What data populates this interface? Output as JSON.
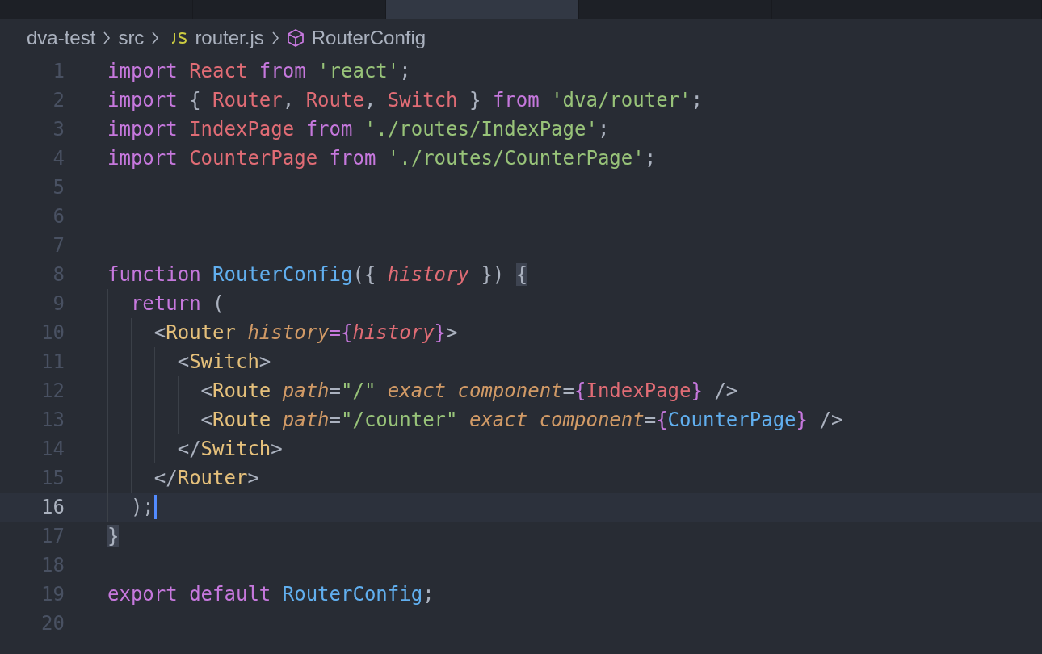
{
  "tabs": [
    {
      "selected": false
    },
    {
      "selected": false
    },
    {
      "selected": true
    },
    {
      "selected": false
    },
    {
      "selected": false
    }
  ],
  "breadcrumb": [
    {
      "text": "dva-test",
      "kind": "folder"
    },
    {
      "text": "src",
      "kind": "folder"
    },
    {
      "text": "router.js",
      "kind": "js-file"
    },
    {
      "text": "RouterConfig",
      "kind": "symbol"
    }
  ],
  "lines": [
    {
      "number": "1",
      "current": false,
      "tokens": [
        {
          "t": "import",
          "kind": "kw"
        },
        {
          "t": " React",
          "kind": "var"
        },
        {
          "t": " from",
          "kind": "kw"
        },
        {
          "t": " 'react'",
          "kind": "str"
        },
        {
          "t": ";",
          "kind": "p"
        }
      ]
    },
    {
      "number": "2",
      "current": false,
      "tokens": [
        {
          "t": "import",
          "kind": "kw"
        },
        {
          "t": " { ",
          "kind": "p"
        },
        {
          "t": "Router",
          "kind": "var"
        },
        {
          "t": ", ",
          "kind": "p"
        },
        {
          "t": "Route",
          "kind": "var"
        },
        {
          "t": ", ",
          "kind": "p"
        },
        {
          "t": "Switch",
          "kind": "var"
        },
        {
          "t": " } ",
          "kind": "p"
        },
        {
          "t": "from",
          "kind": "kw"
        },
        {
          "t": " 'dva/router'",
          "kind": "str"
        },
        {
          "t": ";",
          "kind": "p"
        }
      ]
    },
    {
      "number": "3",
      "current": false,
      "tokens": [
        {
          "t": "import",
          "kind": "kw"
        },
        {
          "t": " IndexPage",
          "kind": "var"
        },
        {
          "t": " from",
          "kind": "kw"
        },
        {
          "t": " './routes/IndexPage'",
          "kind": "str"
        },
        {
          "t": ";",
          "kind": "p"
        }
      ]
    },
    {
      "number": "4",
      "current": false,
      "tokens": [
        {
          "t": "import",
          "kind": "kw"
        },
        {
          "t": " CounterPage",
          "kind": "var"
        },
        {
          "t": " from",
          "kind": "kw"
        },
        {
          "t": " './routes/CounterPage'",
          "kind": "str"
        },
        {
          "t": ";",
          "kind": "p"
        }
      ]
    },
    {
      "number": "5",
      "current": false
    },
    {
      "number": "6",
      "current": false
    },
    {
      "number": "7",
      "current": false
    },
    {
      "number": "8",
      "current": false,
      "tokens": [
        {
          "t": "function",
          "kind": "kw"
        },
        {
          "t": " RouterConfig",
          "kind": "fn"
        },
        {
          "t": "({ ",
          "kind": "p"
        },
        {
          "t": "history",
          "kind": "param"
        },
        {
          "t": " }) ",
          "kind": "p"
        },
        {
          "t": "{",
          "kind": "match"
        }
      ]
    },
    {
      "number": "9",
      "current": false,
      "tokens": [
        {
          "t": "  return",
          "kind": "kw"
        },
        {
          "t": " (",
          "kind": "p"
        }
      ]
    },
    {
      "number": "10",
      "current": false,
      "tokens": [
        {
          "t": "    <",
          "kind": "p"
        },
        {
          "t": "Router",
          "kind": "tag"
        },
        {
          "t": " history",
          "kind": "attr"
        },
        {
          "t": "=",
          "kind": "kw"
        },
        {
          "t": "{",
          "kind": "kw"
        },
        {
          "t": "history",
          "kind": "param"
        },
        {
          "t": "}",
          "kind": "kw"
        },
        {
          "t": ">",
          "kind": "p"
        }
      ]
    },
    {
      "number": "11",
      "current": false,
      "tokens": [
        {
          "t": "      <",
          "kind": "p"
        },
        {
          "t": "Switch",
          "kind": "tag"
        },
        {
          "t": ">",
          "kind": "p"
        }
      ]
    },
    {
      "number": "12",
      "current": false,
      "tokens": [
        {
          "t": "        <",
          "kind": "p"
        },
        {
          "t": "Route",
          "kind": "tag"
        },
        {
          "t": " path",
          "kind": "attr"
        },
        {
          "t": "=",
          "kind": "p"
        },
        {
          "t": "\"/\"",
          "kind": "str"
        },
        {
          "t": " exact",
          "kind": "attr"
        },
        {
          "t": " component",
          "kind": "attr"
        },
        {
          "t": "=",
          "kind": "p"
        },
        {
          "t": "{",
          "kind": "kw"
        },
        {
          "t": "IndexPage",
          "kind": "var"
        },
        {
          "t": "}",
          "kind": "kw"
        },
        {
          "t": " />",
          "kind": "p"
        }
      ]
    },
    {
      "number": "13",
      "current": false,
      "tokens": [
        {
          "t": "        <",
          "kind": "p"
        },
        {
          "t": "Route",
          "kind": "tag"
        },
        {
          "t": " path",
          "kind": "attr"
        },
        {
          "t": "=",
          "kind": "p"
        },
        {
          "t": "\"/counter\"",
          "kind": "str"
        },
        {
          "t": " exact",
          "kind": "attr"
        },
        {
          "t": " component",
          "kind": "attr"
        },
        {
          "t": "=",
          "kind": "p"
        },
        {
          "t": "{",
          "kind": "kw"
        },
        {
          "t": "CounterPage",
          "kind": "fn"
        },
        {
          "t": "}",
          "kind": "kw"
        },
        {
          "t": " />",
          "kind": "p"
        }
      ]
    },
    {
      "number": "14",
      "current": false,
      "tokens": [
        {
          "t": "      </",
          "kind": "p"
        },
        {
          "t": "Switch",
          "kind": "tag"
        },
        {
          "t": ">",
          "kind": "p"
        }
      ]
    },
    {
      "number": "15",
      "current": false,
      "tokens": [
        {
          "t": "    </",
          "kind": "p"
        },
        {
          "t": "Router",
          "kind": "tag"
        },
        {
          "t": ">",
          "kind": "p"
        }
      ]
    },
    {
      "number": "16",
      "current": true,
      "tokens": [
        {
          "t": "  );",
          "kind": "p"
        }
      ]
    },
    {
      "number": "17",
      "current": false,
      "tokens": [
        {
          "t": "}",
          "kind": "match"
        }
      ]
    },
    {
      "number": "18",
      "current": false
    },
    {
      "number": "19",
      "current": false,
      "tokens": [
        {
          "t": "export",
          "kind": "kw"
        },
        {
          "t": " default",
          "kind": "kw"
        },
        {
          "t": " RouterConfig",
          "kind": "fn"
        },
        {
          "t": ";",
          "kind": "p"
        }
      ]
    },
    {
      "number": "20",
      "current": false
    }
  ]
}
